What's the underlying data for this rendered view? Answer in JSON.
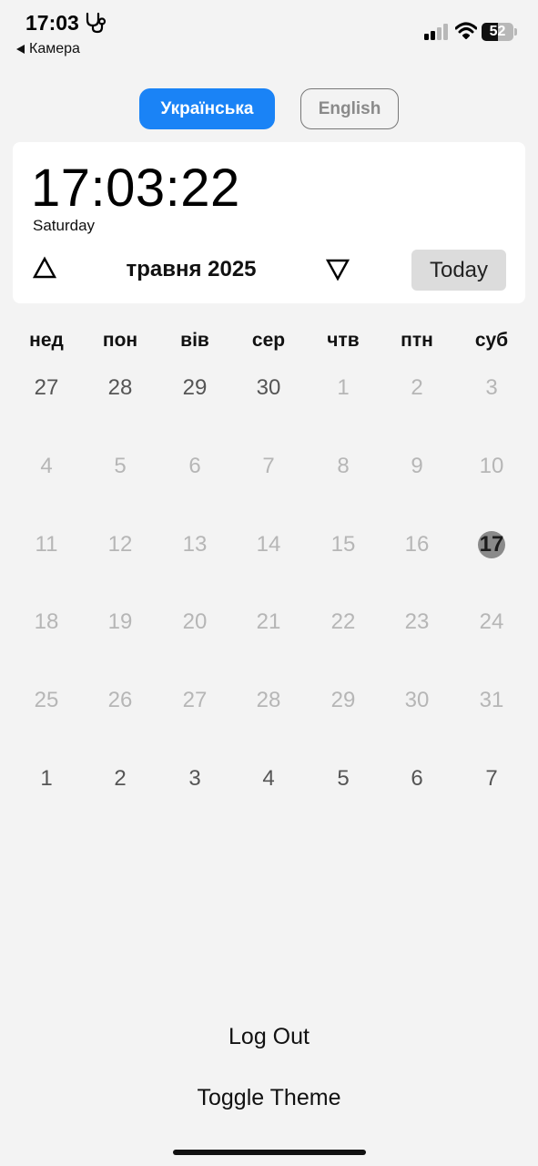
{
  "status_bar": {
    "time": "17:03",
    "back_label": "Камера",
    "battery_level": "52"
  },
  "language": {
    "ukrainian": "Українська",
    "english": "English"
  },
  "clock": {
    "time": "17:03:22",
    "weekday": "Saturday"
  },
  "calendar_nav": {
    "month_label": "травня 2025",
    "today_label": "Today"
  },
  "weekdays": [
    "нед",
    "пон",
    "вів",
    "сер",
    "чтв",
    "птн",
    "суб"
  ],
  "days": [
    [
      "27",
      "28",
      "29",
      "30",
      "1",
      "2",
      "3"
    ],
    [
      "4",
      "5",
      "6",
      "7",
      "8",
      "9",
      "10"
    ],
    [
      "11",
      "12",
      "13",
      "14",
      "15",
      "16",
      "17"
    ],
    [
      "18",
      "19",
      "20",
      "21",
      "22",
      "23",
      "24"
    ],
    [
      "25",
      "26",
      "27",
      "28",
      "29",
      "30",
      "31"
    ],
    [
      "1",
      "2",
      "3",
      "4",
      "5",
      "6",
      "7"
    ]
  ],
  "selected_day": "17",
  "actions": {
    "logout": "Log Out",
    "toggle_theme": "Toggle Theme"
  },
  "colors": {
    "accent": "#1a83f6",
    "background": "#f3f3f3",
    "selected_day": "#8a8a8a"
  }
}
